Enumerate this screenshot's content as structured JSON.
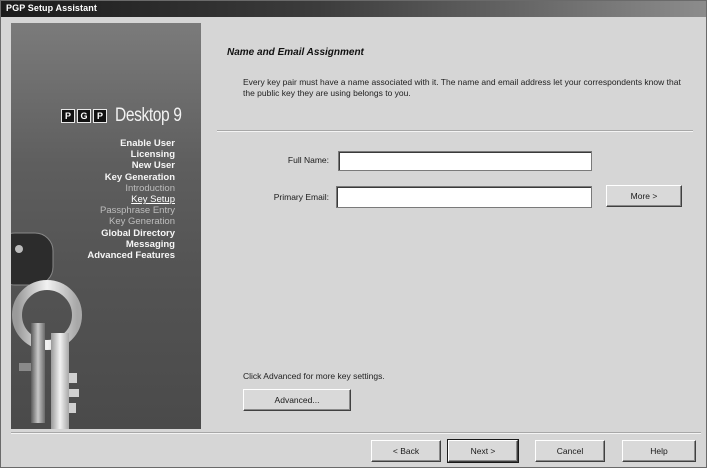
{
  "window": {
    "title": "PGP Setup Assistant"
  },
  "logo": {
    "letters": [
      "P",
      "G",
      "P"
    ],
    "product": "Desktop 9"
  },
  "steps": [
    {
      "label": "Enable User",
      "style": "main"
    },
    {
      "label": "Licensing",
      "style": "main"
    },
    {
      "label": "New User",
      "style": "main"
    },
    {
      "label": "Key Generation",
      "style": "main"
    },
    {
      "label": "Introduction",
      "style": "sub"
    },
    {
      "label": "Key Setup",
      "style": "current"
    },
    {
      "label": "Passphrase Entry",
      "style": "sub"
    },
    {
      "label": "Key Generation",
      "style": "sub"
    },
    {
      "label": "Global Directory",
      "style": "main"
    },
    {
      "label": "Messaging",
      "style": "main"
    },
    {
      "label": "Advanced Features",
      "style": "main"
    }
  ],
  "page": {
    "heading": "Name and Email Assignment",
    "description": "Every key pair must have a name associated with it.  The name and email address let your correspondents know that the public key they are using belongs to you."
  },
  "form": {
    "full_name_label": "Full Name:",
    "full_name_value": "",
    "primary_email_label": "Primary Email:",
    "primary_email_value": "",
    "more_button": "More >"
  },
  "advanced": {
    "note": "Click Advanced for more key settings.",
    "button": "Advanced..."
  },
  "footer": {
    "back": "< Back",
    "next": "Next >",
    "cancel": "Cancel",
    "help": "Help"
  }
}
